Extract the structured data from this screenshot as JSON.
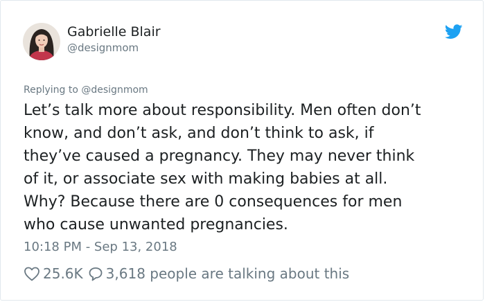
{
  "tweet": {
    "author_name": "Gabrielle Blair",
    "author_handle": "@designmom",
    "platform_icon": "twitter-bird-icon",
    "replying_to": "Replying to @designmom",
    "text_lines": [
      "Let’s talk more about responsibility. Men often don’t",
      "know, and don’t ask, and don’t think to ask, if",
      "they’ve caused a pregnancy. They may never think",
      "of it, or associate sex with making babies at all.",
      "Why? Because there are 0 consequences for men",
      "who cause unwanted pregnancies."
    ],
    "timestamp": "10:18 PM - Sep 13, 2018",
    "likes_count": "25.6K",
    "like_icon": "heart-icon",
    "reply_icon": "speech-bubble-icon",
    "discussion_text": "3,618 people are talking about this"
  },
  "colors": {
    "twitter_blue": "#1da1f2",
    "text_primary": "#1c2022",
    "text_secondary": "#697882",
    "border": "#e1e8ed"
  }
}
